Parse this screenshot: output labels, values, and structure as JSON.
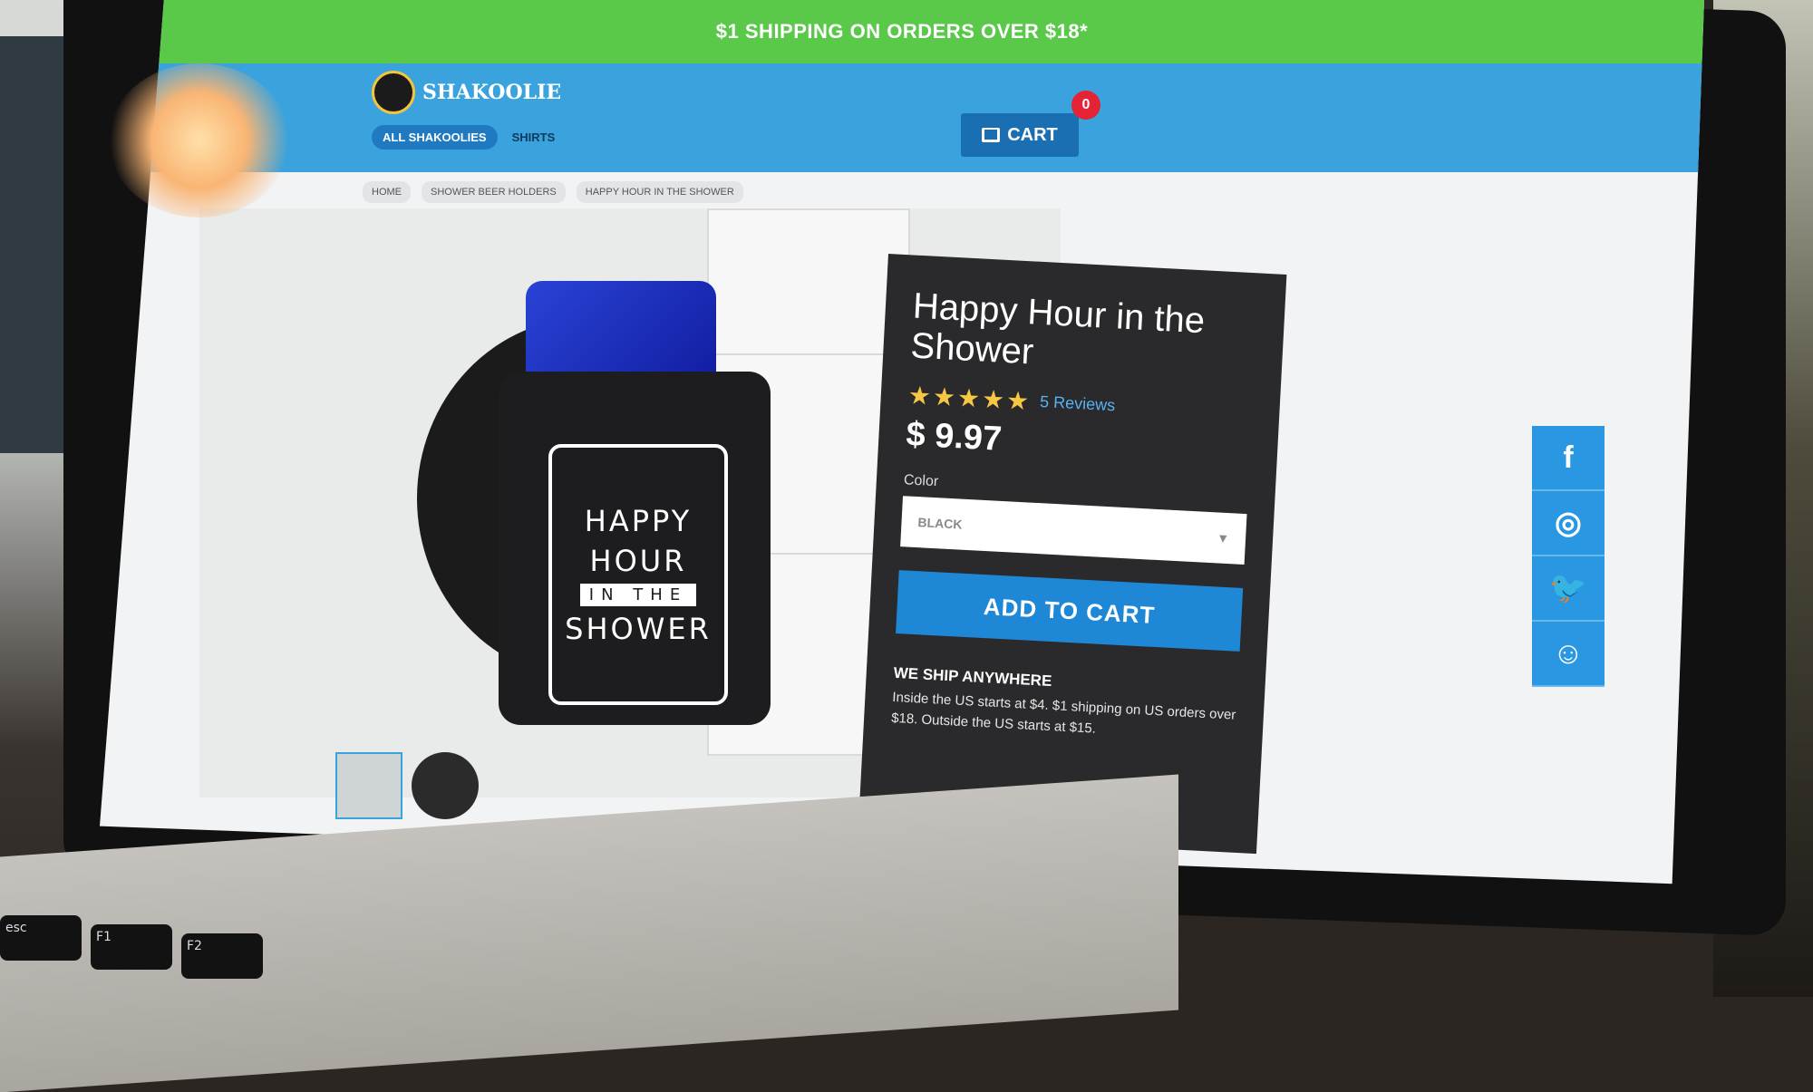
{
  "promo": {
    "text": "$1 SHIPPING ON ORDERS OVER $18*"
  },
  "header": {
    "logo_text": "SHAKOOLIE",
    "nav": [
      "ALL SHAKOOLIES",
      "SHIRTS"
    ],
    "cart_label": "CART",
    "cart_count": "0"
  },
  "breadcrumb": [
    "HOME",
    "SHOWER BEER HOLDERS",
    "HAPPY HOUR IN THE SHOWER"
  ],
  "product": {
    "title": "Happy Hour in the Shower",
    "stars": "★★★★★",
    "reviews": "5 Reviews",
    "price": "$ 9.97",
    "color_label": "Color",
    "color_value": "BLACK",
    "add_to_cart": "ADD TO CART",
    "ship_heading": "WE SHIP ANYWHERE",
    "ship_text": "Inside the US starts at $4. $1 shipping on US orders over $18. Outside the US starts at $15."
  },
  "image_badge": {
    "line1": "HAPPY",
    "line2": "HOUR",
    "line3": "IN THE",
    "line4": "SHOWER"
  },
  "social": [
    "f",
    "◎",
    "🐦",
    "☺"
  ],
  "keyboard": [
    "esc",
    "F1",
    "F2"
  ],
  "colors": {
    "promo": "#5ac94a",
    "header": "#3aa2dc",
    "cart": "#1a6fb3",
    "card": "#2a2a2c",
    "accent": "#1f88d6"
  }
}
